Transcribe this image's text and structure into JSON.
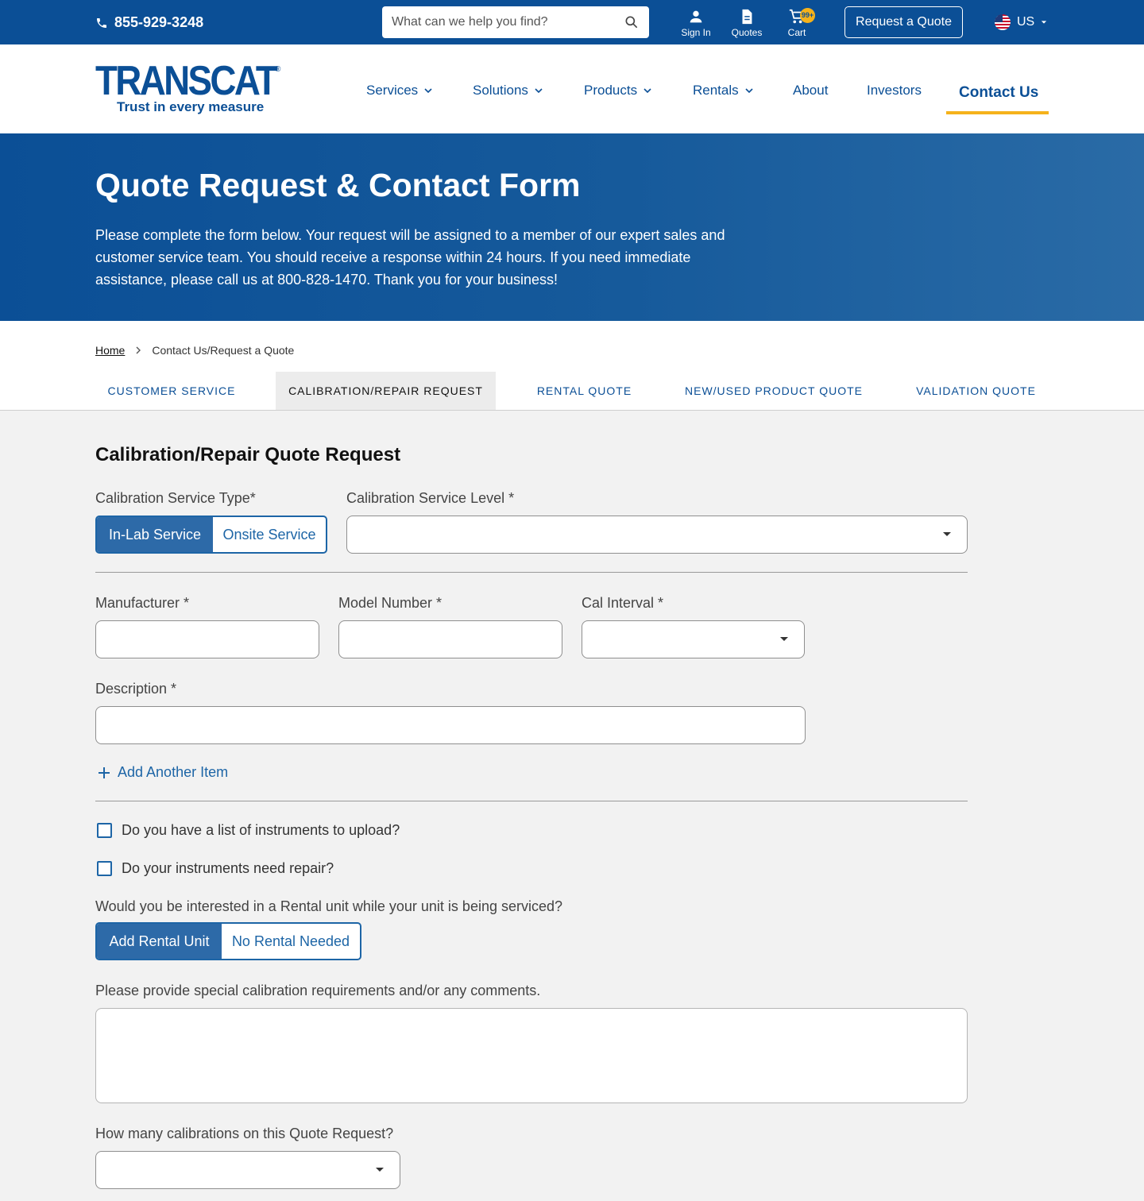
{
  "topbar": {
    "phone": "855-929-3248",
    "search_placeholder": "What can we help you find?",
    "sign_in": "Sign In",
    "quotes": "Quotes",
    "cart": "Cart",
    "cart_badge": "99+",
    "request_quote": "Request a Quote",
    "locale": "US"
  },
  "brand": {
    "name": "TRANSCAT",
    "registered": "®",
    "tagline": "Trust in every measure",
    "color": "#0b4f96",
    "accent": "#f5b21b"
  },
  "nav": {
    "items": [
      {
        "label": "Services"
      },
      {
        "label": "Solutions"
      },
      {
        "label": "Products"
      },
      {
        "label": "Rentals"
      },
      {
        "label": "About"
      },
      {
        "label": "Investors"
      },
      {
        "label": "Contact Us"
      }
    ]
  },
  "hero": {
    "title": "Quote Request & Contact Form",
    "text": "Please complete the form below. Your request will be assigned to a member of our expert sales and customer service team. You should receive a response within 24 hours. If you need immediate assistance, please call us at 800-828-1470. Thank you for your business!"
  },
  "breadcrumb": {
    "home": "Home",
    "current": "Contact Us/Request a Quote"
  },
  "tabs": [
    {
      "label": "CUSTOMER SERVICE"
    },
    {
      "label": "CALIBRATION/REPAIR REQUEST"
    },
    {
      "label": "RENTAL QUOTE"
    },
    {
      "label": "NEW/USED PRODUCT QUOTE"
    },
    {
      "label": "VALIDATION QUOTE"
    }
  ],
  "form": {
    "title": "Calibration/Repair Quote Request",
    "service_type_label": "Calibration Service Type*",
    "service_type_options": [
      "In-Lab Service",
      "Onsite Service"
    ],
    "service_level_label": "Calibration Service Level *",
    "manufacturer_label": "Manufacturer *",
    "model_label": "Model Number *",
    "interval_label": "Cal Interval *",
    "description_label": "Description *",
    "add_item": "Add Another Item",
    "upload_question": "Do you have a list of instruments to upload?",
    "repair_question": "Do your instruments need repair?",
    "rental_question": "Would you be interested in a Rental unit while your unit is being serviced?",
    "rental_options": [
      "Add Rental Unit",
      "No Rental Needed"
    ],
    "comments_label": "Please provide special calibration requirements and/or any comments.",
    "count_label": "How many calibrations on this Quote Request?"
  }
}
